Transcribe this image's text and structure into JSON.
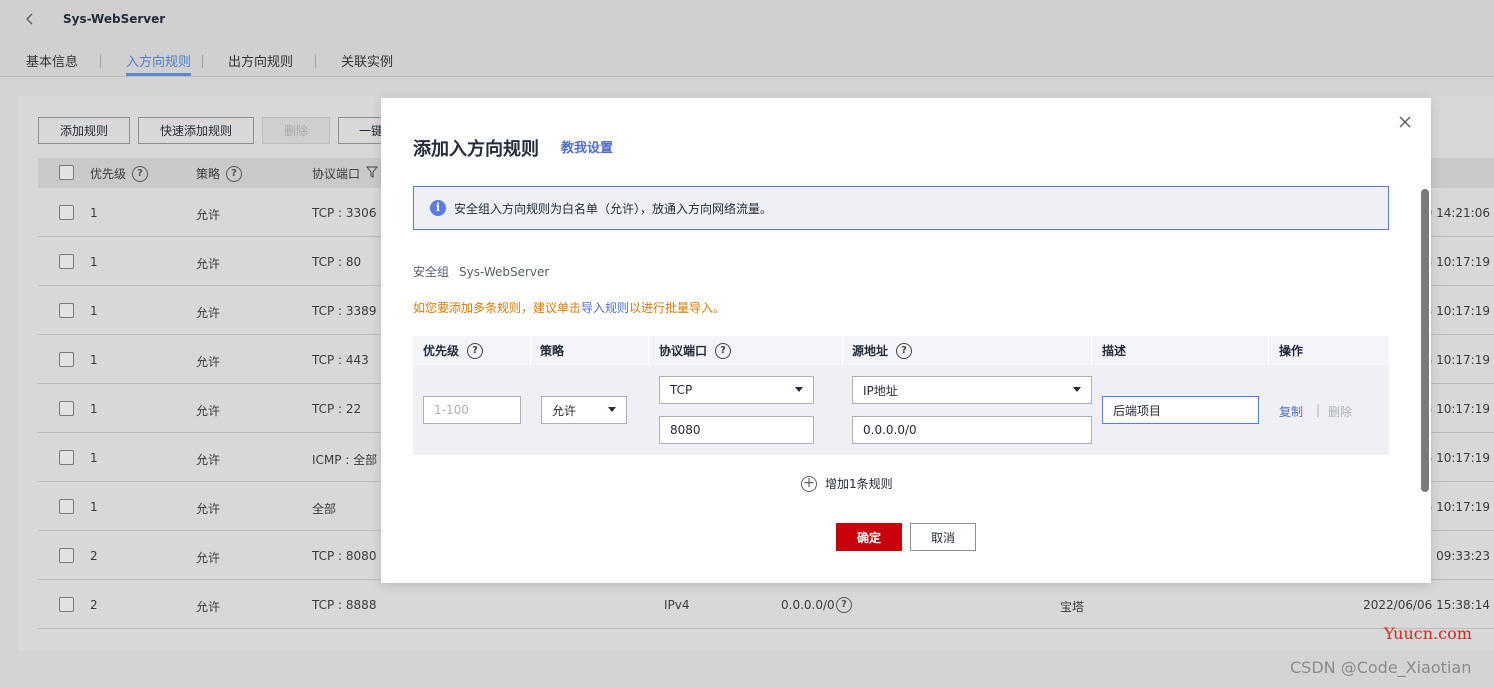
{
  "page": {
    "title": "Sys-WebServer",
    "tabs": [
      {
        "label": "基本信息",
        "active": false
      },
      {
        "label": "入方向规则",
        "active": true
      },
      {
        "label": "出方向规则",
        "active": false
      },
      {
        "label": "关联实例",
        "active": false
      }
    ]
  },
  "toolbar": {
    "add_rule": "添加规则",
    "quick_add": "快速添加规则",
    "delete": "删除",
    "one_click": "一键"
  },
  "rules_table": {
    "headers": {
      "priority": "优先级",
      "policy": "策略",
      "protocol_port": "协议端口"
    },
    "rows": [
      {
        "priority": "1",
        "policy": "允许",
        "port": "TCP : 3306",
        "time": "30 14:21:06"
      },
      {
        "priority": "1",
        "policy": "允许",
        "port": "TCP : 80",
        "time": "28 10:17:19"
      },
      {
        "priority": "1",
        "policy": "允许",
        "port": "TCP : 3389",
        "time": "28 10:17:19"
      },
      {
        "priority": "1",
        "policy": "允许",
        "port": "TCP : 443",
        "time": "28 10:17:19"
      },
      {
        "priority": "1",
        "policy": "允许",
        "port": "TCP : 22",
        "time": "28 10:17:19"
      },
      {
        "priority": "1",
        "policy": "允许",
        "port": "ICMP : 全部",
        "time": "28 10:17:19"
      },
      {
        "priority": "1",
        "policy": "允许",
        "port": "全部",
        "time": "28 10:17:19"
      },
      {
        "priority": "2",
        "policy": "允许",
        "port": "TCP : 8080",
        "time": "07 09:33:23"
      },
      {
        "priority": "2",
        "policy": "允许",
        "port": "TCP : 8888",
        "time": "2022/06/06 15:38:14",
        "type": "IPv4",
        "source": "0.0.0.0/0",
        "desc": "宝塔"
      }
    ]
  },
  "modal": {
    "title": "添加入方向规则",
    "help_link": "教我设置",
    "info_text": "安全组入方向规则为白名单（允许），放通入方向网络流量。",
    "security_group_label": "安全组",
    "security_group_name": "Sys-WebServer",
    "tip_prefix": "如您要添加多条规则，建议单击",
    "tip_link": "导入规则",
    "tip_suffix": "以进行批量导入。",
    "columns": {
      "priority": "优先级",
      "policy": "策略",
      "protocol_port": "协议端口",
      "source": "源地址",
      "description": "描述",
      "action": "操作"
    },
    "row": {
      "priority_placeholder": "1-100",
      "policy_value": "允许",
      "protocol_value": "TCP",
      "port_value": "8080",
      "source_type_value": "IP地址",
      "source_value": "0.0.0.0/0",
      "description_value": "后端项目",
      "copy_label": "复制",
      "delete_label": "删除"
    },
    "add_rule_label": "增加1条规则",
    "ok_label": "确定",
    "cancel_label": "取消"
  },
  "watermarks": {
    "site": "Yuucn.com",
    "csdn": "CSDN @Code_Xiaotian"
  }
}
